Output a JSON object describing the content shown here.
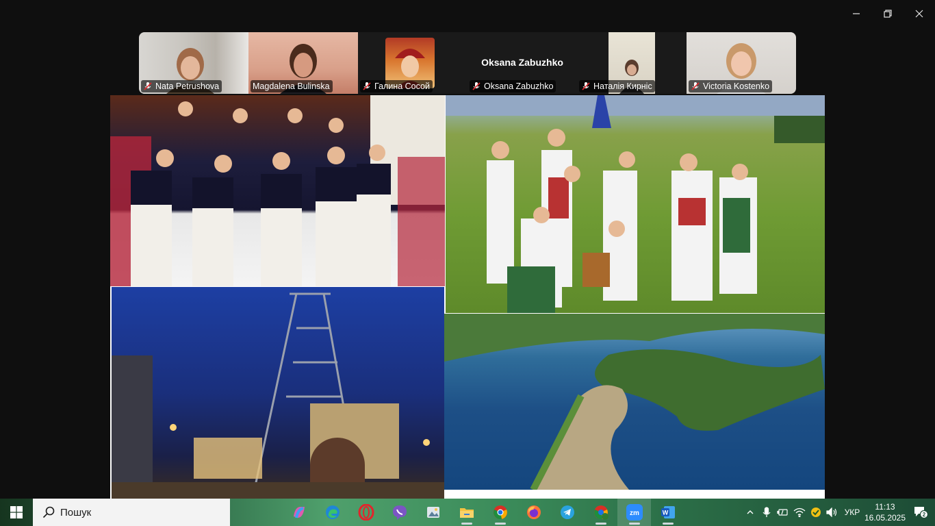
{
  "window": {
    "controls": [
      "minimize-icon",
      "restore-icon",
      "close-icon"
    ]
  },
  "participants": [
    {
      "name": "Nata Petrushova",
      "muted": true,
      "active": false,
      "video": true
    },
    {
      "name": "Magdalena Bulinska",
      "muted": false,
      "active": true,
      "video": true
    },
    {
      "name": "Галина Сосой",
      "muted": true,
      "active": false,
      "video": false,
      "avatar": true
    },
    {
      "name": "Oksana Zabuzhko",
      "muted": true,
      "active": false,
      "video": false,
      "display_name": "Oksana Zabuzhko"
    },
    {
      "name": "Наталія Кирнiс",
      "muted": true,
      "active": false,
      "video": true
    },
    {
      "name": "Victoria Kostenko",
      "muted": true,
      "active": false,
      "video": true
    }
  ],
  "shared_screen": {
    "images": [
      "folk-group-traditional-dress",
      "folk-group-meadow",
      "mine-shaft-tower-night",
      "lake-aerial-view"
    ]
  },
  "taskbar": {
    "search_placeholder": "Пошук",
    "apps": [
      "copilot-icon",
      "edge-icon",
      "opera-icon",
      "viber-icon",
      "photos-icon",
      "file-explorer-icon",
      "chrome-icon",
      "firefox-icon",
      "telegram-icon",
      "chrome-profile-icon",
      "zoom-icon",
      "word-icon"
    ],
    "language": "УКР",
    "time": "11:13",
    "date": "16.05.2025",
    "notifications": "2",
    "colors": {
      "accent": "#2bd26b"
    }
  }
}
